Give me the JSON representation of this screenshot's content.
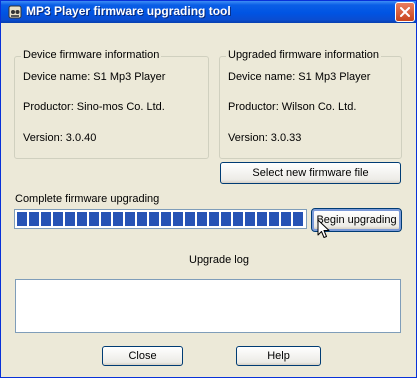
{
  "window": {
    "title": "MP3 Player firmware upgrading tool"
  },
  "device_info": {
    "legend": "Device firmware information",
    "name": "Device name: S1 Mp3 Player",
    "productor": "Productor: Sino-mos Co. Ltd.",
    "version": "Version: 3.0.40"
  },
  "upgraded_info": {
    "legend": "Upgraded firmware information",
    "name": "Device name: S1 Mp3 Player",
    "productor": "Productor: Wilson Co. Ltd.",
    "version": "Version: 3.0.33"
  },
  "select_button": "Select new firmware file",
  "progress": {
    "label": "Complete firmware upgrading",
    "fraction": 1.0
  },
  "begin_button": "Begin upgrading",
  "log": {
    "label": "Upgrade log",
    "content": ""
  },
  "close_button": "Close",
  "help_button": "Help",
  "colors": {
    "titlebar": "#0054e3",
    "progress_fill": "#2653b5",
    "window_bg": "#ece9d8"
  }
}
